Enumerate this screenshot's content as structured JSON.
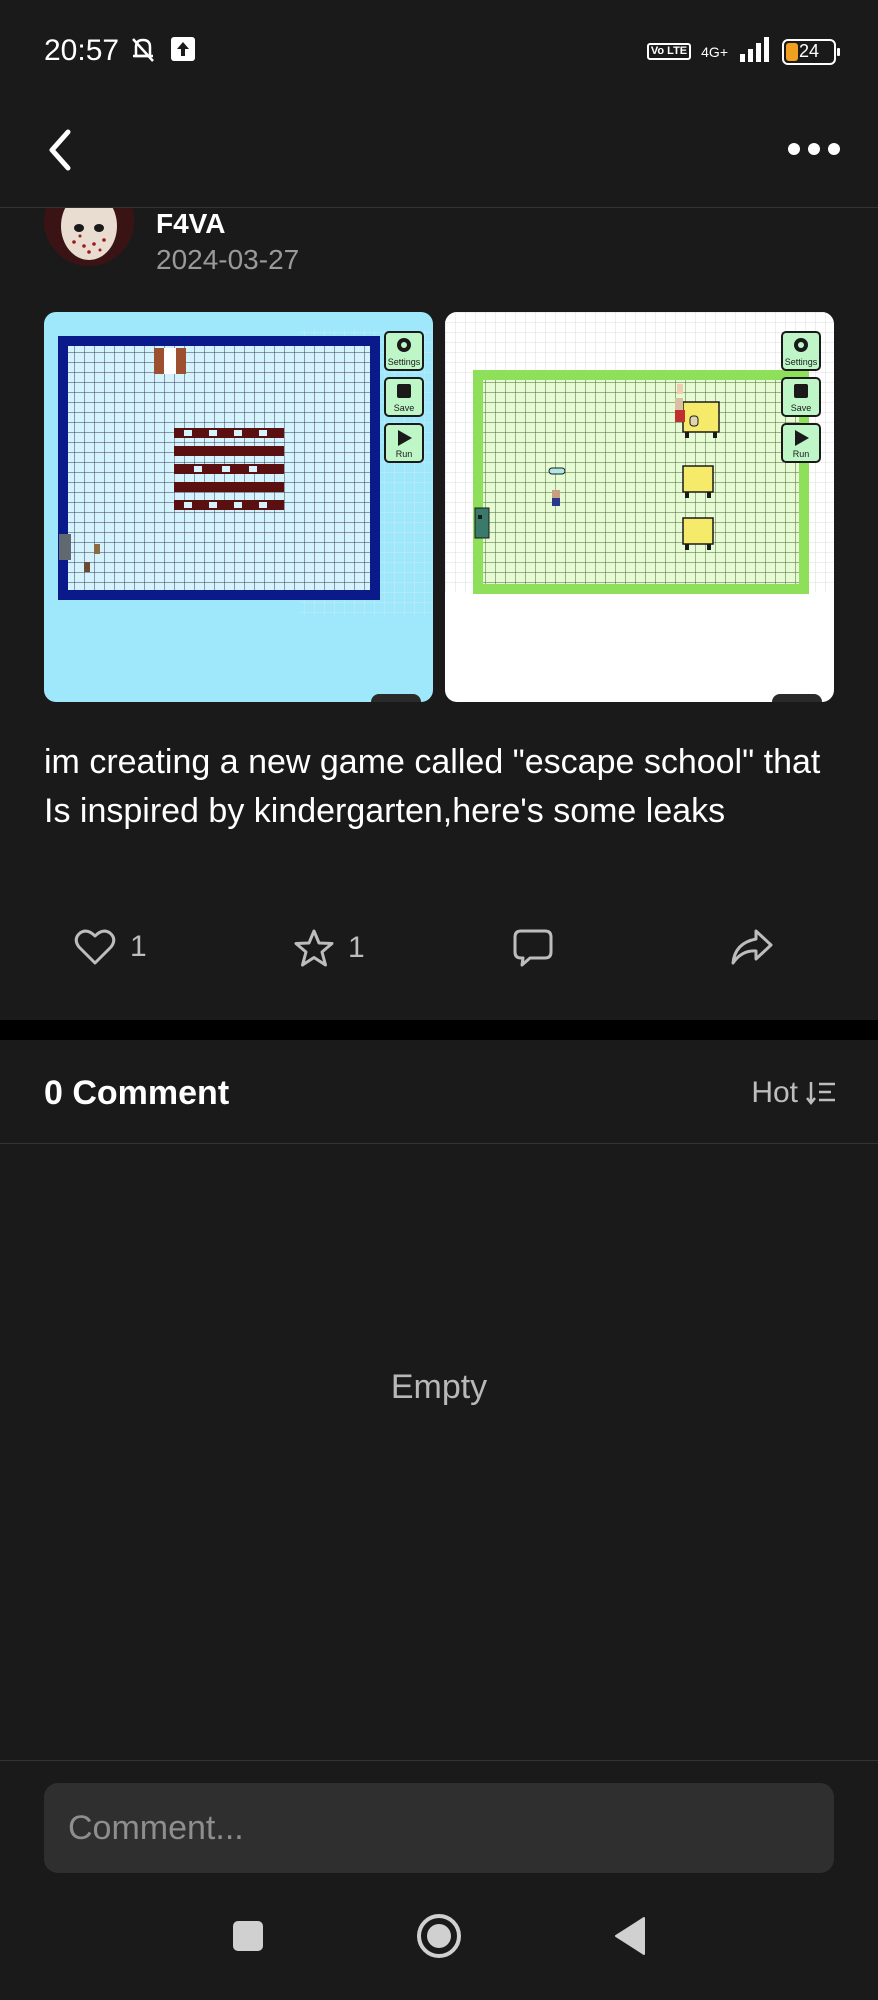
{
  "status": {
    "time": "20:57",
    "network": "4G+",
    "volte": "Vo LTE",
    "battery": "24",
    "battery_level": 0.24,
    "icons": [
      "mute-bell-icon",
      "upload-icon",
      "signal-icon",
      "battery-icon"
    ]
  },
  "nav": {
    "back_icon": "chevron-left-icon",
    "more_icon": "more-dots-icon"
  },
  "post": {
    "author": "F4VA",
    "date": "2024-03-27",
    "images": [
      {
        "buttons": [
          "Settings",
          "Save",
          "Run"
        ]
      },
      {
        "buttons": [
          "Settings",
          "Save",
          "Run"
        ]
      }
    ],
    "text": "im creating a new game called \"escape school\" that Is inspired by kindergarten,here's some leaks"
  },
  "actions": {
    "likes": "1",
    "favorites": "1"
  },
  "comments": {
    "title": "0 Comment",
    "sort_label": "Hot",
    "empty_label": "Empty",
    "input_placeholder": "Comment..."
  },
  "colors": {
    "background": "#1a1a1a",
    "divider": "#000000",
    "muted_text": "#9a9a9a",
    "input_bg": "#2f2f2f",
    "battery": "#f0a020"
  }
}
